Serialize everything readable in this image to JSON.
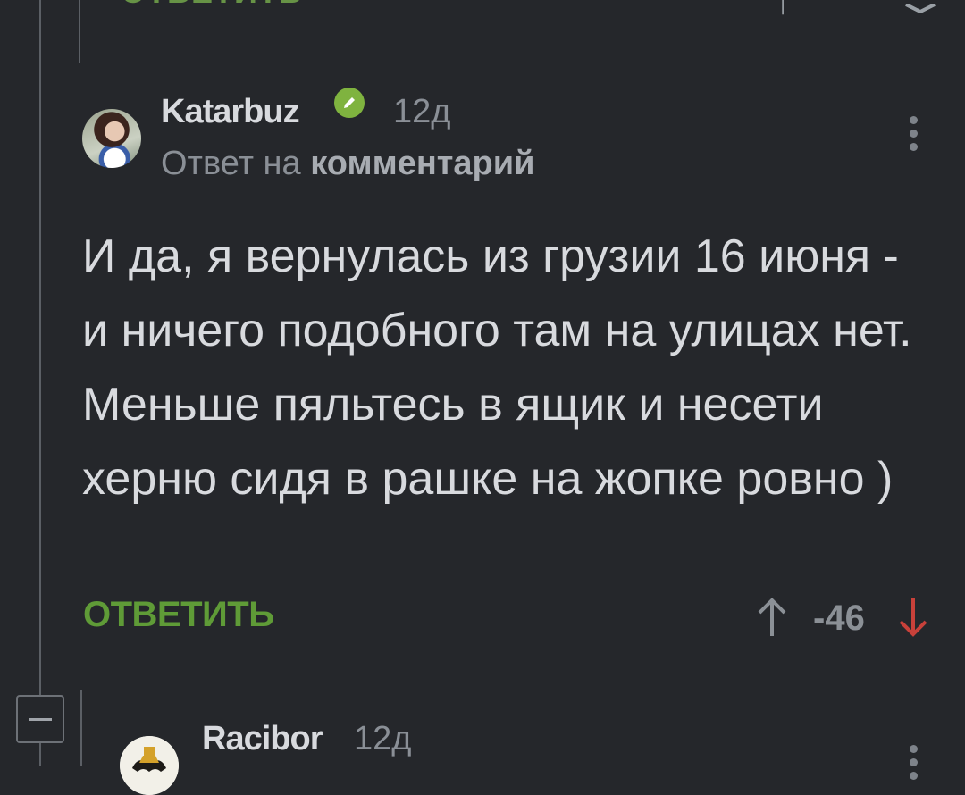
{
  "prev_comment": {
    "reply_label": "ОТВЕТИТЬ"
  },
  "comment": {
    "username": "Katarbuz",
    "verified_icon": "pencil-check-icon",
    "time": "12д",
    "reply_to_prefix": "Ответ на",
    "reply_to_target": "комментарий",
    "text": "И да, я вернулась из грузии 16 июня - и ничего подобного там на улицах нет. Меньше пяльтесь в ящик и несети херню сидя в рашке на жопке ровно )",
    "reply_label": "ОТВЕТИТЬ",
    "rating": "-46",
    "colors": {
      "accent": "#5f9b37",
      "downvote": "#c8413a",
      "badge": "#7fb33f"
    }
  },
  "next_comment": {
    "username": "Racibor",
    "time": "12д"
  }
}
